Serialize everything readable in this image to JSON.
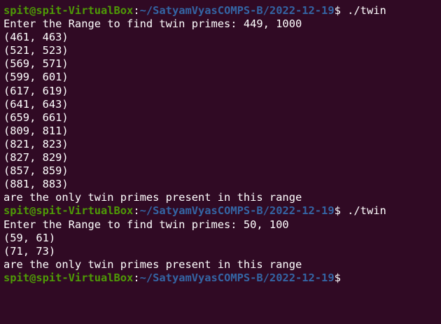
{
  "colors": {
    "background": "#300a24",
    "prompt_user": "#4e9a06",
    "prompt_path": "#3465a4",
    "text": "#ffffff"
  },
  "session1": {
    "prompt": {
      "user": "spit@spit-VirtualBox",
      "sep": ":",
      "path": "~/SatyamVyasCOMPS-B/2022-12-19",
      "dollar": "$ ",
      "command": "./twin"
    },
    "input_line": "Enter the Range to find twin primes: 449, 1000",
    "pairs": [
      "(461, 463)",
      "(521, 523)",
      "(569, 571)",
      "(599, 601)",
      "(617, 619)",
      "(641, 643)",
      "(659, 661)",
      "(809, 811)",
      "(821, 823)",
      "(827, 829)",
      "(857, 859)",
      "(881, 883)"
    ],
    "summary": "are the only twin primes present in this range"
  },
  "session2": {
    "prompt": {
      "user": "spit@spit-VirtualBox",
      "sep": ":",
      "path": "~/SatyamVyasCOMPS-B/2022-12-19",
      "dollar": "$ ",
      "command": "./twin"
    },
    "input_line": "Enter the Range to find twin primes: 50, 100",
    "pairs": [
      "(59, 61)",
      "(71, 73)"
    ],
    "summary": "are the only twin primes present in this range"
  },
  "final_prompt": {
    "user": "spit@spit-VirtualBox",
    "sep": ":",
    "path": "~/SatyamVyasCOMPS-B/2022-12-19",
    "dollar": "$"
  }
}
